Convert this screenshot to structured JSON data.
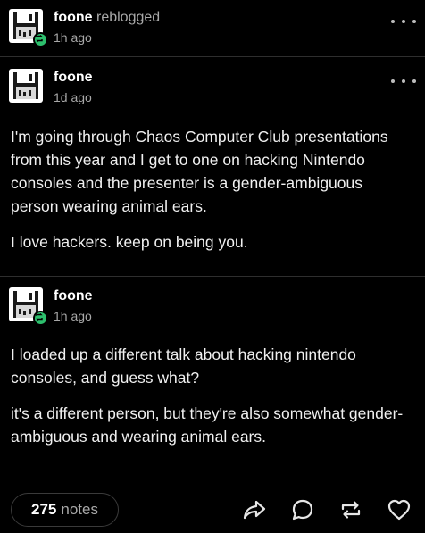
{
  "reblog_header": {
    "user": "foone",
    "action": "reblogged",
    "time": "1h ago",
    "avatar_icon": "floppy-disk-icon",
    "badge_icon": "reblog-badge-icon"
  },
  "posts": [
    {
      "user": "foone",
      "time": "1d ago",
      "avatar_icon": "floppy-disk-icon",
      "paragraphs": [
        "I'm going through Chaos Computer Club presentations from this year and I get to one on hacking Nintendo consoles and the presenter is a gender-ambiguous person wearing animal ears.",
        "I love hackers. keep on being you."
      ]
    },
    {
      "user": "foone",
      "time": "1h ago",
      "avatar_icon": "floppy-disk-icon",
      "badge_icon": "reblog-badge-icon",
      "paragraphs": [
        "I loaded up a different talk about hacking nintendo consoles, and guess what?",
        "it's a different person, but they're also somewhat gender-ambiguous and wearing animal ears."
      ]
    }
  ],
  "footer": {
    "notes_count": "275",
    "notes_label": "notes",
    "icons": [
      "share-icon",
      "reply-icon",
      "reblog-icon",
      "like-icon"
    ]
  },
  "colors": {
    "background": "#000000",
    "badge": "#2dbf6d",
    "muted_text": "#a8a8a8"
  }
}
